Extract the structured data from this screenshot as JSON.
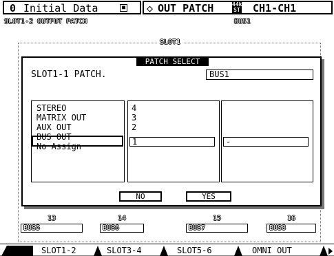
{
  "header": {
    "scene_number": "0",
    "scene_title": "Initial Data",
    "protect_icon": "protect-icon",
    "page_title": "OUT PATCH",
    "fs_badge_top": "44k",
    "fs_badge_bottom": "ST",
    "channel_range": "CH1-CH1",
    "background_page": "SLOT1-2 OUTPUT PATCH",
    "background_bus": "BUS1",
    "background_slot": "SLOT1"
  },
  "dialog": {
    "title": "PATCH SELECT",
    "slot_label": "SLOT1-1 PATCH.",
    "current_value": "BUS1",
    "categories": [
      "STEREO",
      "MATRIX OUT",
      "AUX OUT",
      "BUS OUT",
      "No Assign"
    ],
    "selected_category": "BUS OUT",
    "numbers": [
      "4",
      "3",
      "2",
      "1"
    ],
    "selected_number": "1",
    "third_column_value": "-",
    "no_label": "NO",
    "yes_label": "YES"
  },
  "background_slots": [
    {
      "number": "13",
      "value": "BUS5"
    },
    {
      "number": "14",
      "value": "BUS6"
    },
    {
      "number": "15",
      "value": "BUS7"
    },
    {
      "number": "16",
      "value": "BUS8"
    }
  ],
  "tabs": [
    {
      "label": "SLOT1-2",
      "active": true
    },
    {
      "label": "SLOT3-4",
      "active": false
    },
    {
      "label": "SLOT5-6",
      "active": false
    },
    {
      "label": "OMNI OUT",
      "active": false
    }
  ],
  "colors": {
    "foreground": "#000000",
    "background": "#ffffff",
    "shadow": "#777777"
  }
}
